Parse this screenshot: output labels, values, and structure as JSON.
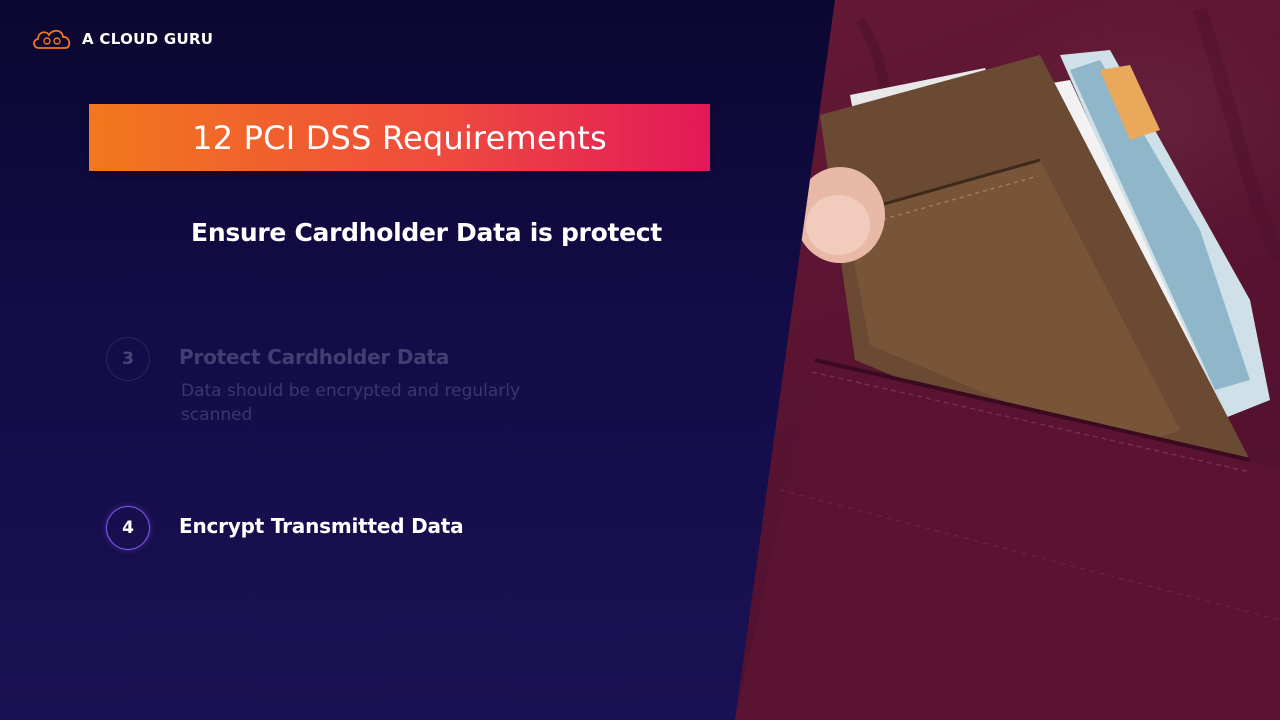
{
  "brand": {
    "name": "A CLOUD GURU",
    "accent_gradient": [
      "#f2771d",
      "#e2185a"
    ]
  },
  "slide": {
    "title": "12 PCI DSS Requirements",
    "subtitle": "Ensure Cardholder Data is protect"
  },
  "requirements": [
    {
      "number": "3",
      "title": "Protect Cardholder Data",
      "description": "Data should be encrypted and regularly scanned",
      "state": "dimmed"
    },
    {
      "number": "4",
      "title": "Encrypt Transmitted Data",
      "description": "",
      "state": "active"
    }
  ],
  "photo": {
    "subject": "wallet-in-pocket-photo",
    "colors": {
      "fabric": "#5e1632",
      "wallet": "#6b4a33"
    }
  }
}
